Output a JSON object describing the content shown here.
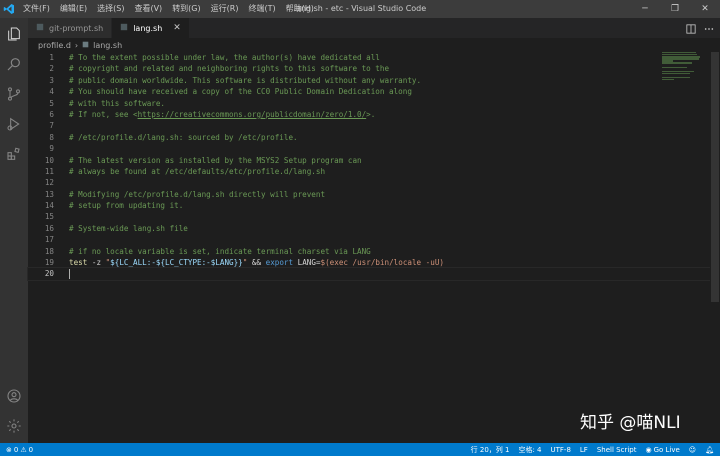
{
  "window": {
    "title": "lang.sh - etc - Visual Studio Code",
    "menu": [
      "文件(F)",
      "编辑(E)",
      "选择(S)",
      "查看(V)",
      "转到(G)",
      "运行(R)",
      "终端(T)",
      "帮助(H)"
    ],
    "controls": {
      "minimize": "─",
      "maximize": "❐",
      "close": "✕"
    }
  },
  "tabs": [
    {
      "label": "git-prompt.sh",
      "active": false
    },
    {
      "label": "lang.sh",
      "active": true,
      "close": "✕"
    }
  ],
  "breadcrumb": {
    "folder": "profile.d",
    "separator": "›",
    "file": "lang.sh"
  },
  "editor": {
    "lines": [
      {
        "n": "1",
        "text": "# To the extent possible under law, the author(s) have dedicated all"
      },
      {
        "n": "2",
        "text": "# copyright and related and neighboring rights to this software to the"
      },
      {
        "n": "3",
        "text": "# public domain worldwide. This software is distributed without any warranty."
      },
      {
        "n": "4",
        "text": "# You should have received a copy of the CC0 Public Domain Dedication along"
      },
      {
        "n": "5",
        "text": "# with this software."
      },
      {
        "n": "6",
        "text_pre": "# If not, see <",
        "link": "https://creativecommons.org/publicdomain/zero/1.0/",
        "text_post": ">."
      },
      {
        "n": "7",
        "text": ""
      },
      {
        "n": "8",
        "text": "# /etc/profile.d/lang.sh: sourced by /etc/profile."
      },
      {
        "n": "9",
        "text": ""
      },
      {
        "n": "10",
        "text": "# The latest version as installed by the MSYS2 Setup program can"
      },
      {
        "n": "11",
        "text": "# always be found at /etc/defaults/etc/profile.d/lang.sh"
      },
      {
        "n": "12",
        "text": ""
      },
      {
        "n": "13",
        "text": "# Modifying /etc/profile.d/lang.sh directly will prevent"
      },
      {
        "n": "14",
        "text": "# setup from updating it."
      },
      {
        "n": "15",
        "text": ""
      },
      {
        "n": "16",
        "text": "# System-wide lang.sh file"
      },
      {
        "n": "17",
        "text": ""
      },
      {
        "n": "18",
        "text": "# if no locale variable is set, indicate terminal charset via LANG"
      },
      {
        "n": "19",
        "tokens": {
          "t1": "test",
          "t2": " -z ",
          "t3": "\"",
          "t4": "${LC_ALL:-${LC_CTYPE:-$LANG}}",
          "t5": "\"",
          "t6": " && ",
          "t7": "export",
          "t8": " ",
          "t9": "LANG",
          "t10": "=",
          "t11": "$(exec /usr/bin/locale -uU)"
        }
      },
      {
        "n": "20",
        "text": ""
      }
    ]
  },
  "watermark": "知乎 @喵NLI",
  "status": {
    "problems_errors": "0",
    "problems_warnings": "0",
    "position": "行 20，列 1",
    "spaces": "空格: 4",
    "encoding": "UTF-8",
    "eol": "LF",
    "language": "Shell Script",
    "go_live": "Go Live"
  },
  "colors": {
    "accent": "#007acc",
    "comment": "#6a9955",
    "string": "#ce9178",
    "keyword": "#569cd6",
    "function": "#dcdcaa",
    "variable": "#9cdcfe"
  }
}
